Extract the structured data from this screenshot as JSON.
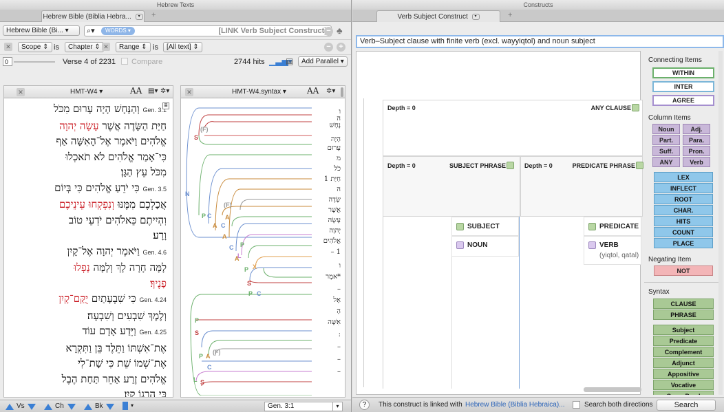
{
  "left": {
    "window_title": "Hebrew Texts",
    "tab_label": "Hebrew Bible (Biblia Hebra...",
    "text_select": "Hebrew Bible (Bi...",
    "search_mode": "WORDS",
    "search_query": "[LINK Verb Subject Construct]",
    "scope_label": "Scope",
    "scope_is": "is",
    "scope_value": "Chapter",
    "range_label": "Range",
    "range_is": "is",
    "range_value": "[All text]",
    "slider_value": "0",
    "verse_position": "Verse 4 of 2231",
    "compare_label": "Compare",
    "hits": "2744 hits",
    "add_parallel": "Add Parallel",
    "pane1_title": "HMT-W4",
    "pane2_title": "HMT-W4.syntax",
    "font_size_label": "AA",
    "text_lines": [
      {
        "ref": "Gen. 3.1",
        "text": "וְהַנָּחָשׁ הָיָה עָרוּם מִכֹּל",
        "red": ""
      },
      {
        "ref": "",
        "text": "חַיַּת הַשָּׂדֶה אֲשֶׁר",
        "red": "עָשָׂה יְהוָה"
      },
      {
        "ref": "",
        "text": "אֱלֹהִים וַיֹּאמֶר אֶל־הָאִשָּׁה אַף",
        "red": ""
      },
      {
        "ref": "",
        "text": "כִּי־אָמַר אֱלֹהִים לֹא תֹאכְלוּ",
        "red": ""
      },
      {
        "ref": "",
        "text": "מִכֹּל עֵץ הַגָּן׃",
        "red": ""
      },
      {
        "ref": "Gen. 3.5",
        "text": "כִּי יֹדֵעַ אֱלֹהִים כִּי בְּיוֹם",
        "red": ""
      },
      {
        "ref": "",
        "text": "אֲכָלְכֶם מִמֶּנּוּ",
        "red": "וְנִפְקְחוּ עֵינֵיכֶם"
      },
      {
        "ref": "",
        "text": "וִהְיִיתֶם כֵּאלֹהִים יֹדְעֵי טוֹב",
        "red": ""
      },
      {
        "ref": "",
        "text": "וָרָע׃",
        "red": ""
      },
      {
        "ref": "Gen. 4.6",
        "text": "וַיֹּאמֶר יְהוָה אֶל־קָיִן",
        "red": ""
      },
      {
        "ref": "",
        "text": "לָמָּה חָרָה לָךְ וְלָמָּה",
        "red": "נָפְלוּ"
      },
      {
        "ref": "",
        "text": "",
        "red": "פָנֶיךָ׃"
      },
      {
        "ref": "Gen. 4.24",
        "text": "כִּי שִׁבְעָתַיִם",
        "red": "יֻקַּם־קָיִן"
      },
      {
        "ref": "",
        "text": "וְלֶמֶךְ שִׁבְעִים וְשִׁבְעָה׃",
        "red": ""
      },
      {
        "ref": "Gen. 4.25",
        "text": "וַיֵּדַע אָדָם עוֹד",
        "red": ""
      },
      {
        "ref": "",
        "text": "אֶת־אִשְׁתּוֹ וַתֵּלֶד בֵּן וַתִּקְרָא",
        "red": ""
      },
      {
        "ref": "",
        "text": "אֶת־שְׁמוֹ שֵׁת כִּי שָׁת־לִי",
        "red": ""
      },
      {
        "ref": "",
        "text": "אֱלֹהִים זֶרַע אַחֵר תַּחַת הֶבֶל",
        "red": ""
      },
      {
        "ref": "",
        "text": "כִּי הֲרָגוֹ קָיִן׃",
        "red": ""
      }
    ],
    "syntax_words": [
      "ו",
      "ה",
      "נָחָשׁ",
      "הָיָה",
      "עָרוּם",
      "מ",
      "כֹל",
      "חַיַּת 1",
      "ה",
      "שָׂדֶה",
      "אֲשֶׁר",
      "עָשָׂה",
      "יְהוָה",
      "אֱלֹהִים",
      "1 –",
      "ו",
      "*אמֶר",
      "–",
      "אֶל",
      "הָ",
      "אִשָּׁה",
      ":",
      "–",
      "–",
      "–"
    ],
    "bottom_nav": {
      "vs": "Vs",
      "ch": "Ch",
      "bk": "Bk",
      "location": "Gen. 3:1"
    }
  },
  "right": {
    "window_title": "Constructs",
    "tab_label": "Verb Subject Construct",
    "description": "Verb–Subject clause with finite verb (excl. wayyiqtol) and noun subject",
    "depth_label": "Depth = 0",
    "any_clause": "ANY CLAUSE",
    "subject_phrase": "SUBJECT PHRASE",
    "predicate_phrase": "PREDICATE PHRASE",
    "subject_item": "SUBJECT",
    "noun_item": "NOUN",
    "predicate_item": "PREDICATE",
    "verb_item": "VERB",
    "verb_detail": "(yiqtol, qatal)",
    "link_text_prefix": "This construct is linked with",
    "link_text_link": "Hebrew Bible (Biblia Hebraica)...",
    "search_both": "Search both directions",
    "search_button": "Search",
    "help": "?",
    "sidebar": {
      "connecting_title": "Connecting Items",
      "within": "WITHIN",
      "inter": "INTER",
      "agree": "AGREE",
      "column_title": "Column Items",
      "grid": [
        "Noun",
        "Adj.",
        "Part.",
        "Para.",
        "Suff.",
        "Pron.",
        "ANY",
        "Verb"
      ],
      "blue": [
        "LEX",
        "INFLECT",
        "ROOT",
        "CHAR.",
        "HITS",
        "COUNT",
        "PLACE"
      ],
      "negating_title": "Negating Item",
      "not": "NOT",
      "syntax_title": "Syntax",
      "syntax_top": [
        "CLAUSE",
        "PHRASE"
      ],
      "syntax_bottom": [
        "Subject",
        "Predicate",
        "Complement",
        "Adjunct",
        "Appositive",
        "Vocative",
        "CasusPend"
      ]
    }
  }
}
